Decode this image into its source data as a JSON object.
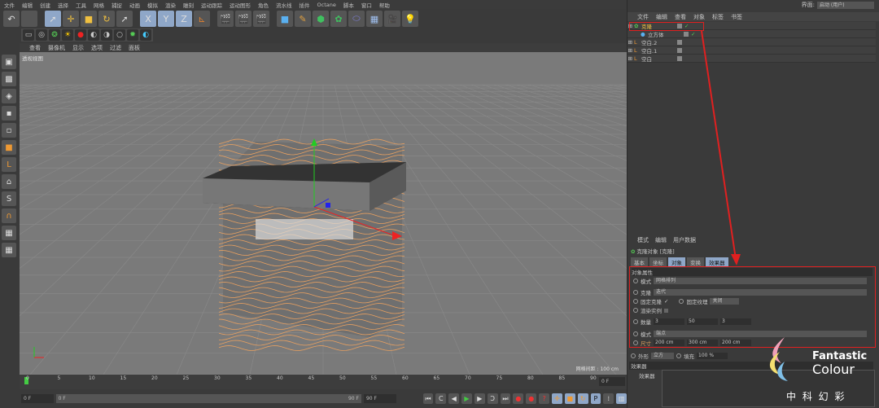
{
  "menu": [
    "文件",
    "编辑",
    "创建",
    "选择",
    "工具",
    "网格",
    "捕捉",
    "动画",
    "模拟",
    "渲染",
    "雕刻",
    "运动跟踪",
    "运动图形",
    "角色",
    "流水线",
    "插件",
    "Octane",
    "脚本",
    "窗口",
    "帮助"
  ],
  "interface": {
    "label": "界面:",
    "value": "启动 (用户)"
  },
  "viewport": {
    "menu": [
      "查看",
      "摄像机",
      "显示",
      "选项",
      "过滤",
      "面板"
    ],
    "label": "透视视图",
    "grid_spacing": "网格间距 : 100 cm"
  },
  "object_manager": {
    "menu": [
      "文件",
      "编辑",
      "查看",
      "对象",
      "标签",
      "书签"
    ],
    "objects": [
      "克隆",
      "立方体",
      "空白.2",
      "空白.1",
      "空白"
    ]
  },
  "attributes": {
    "menu": [
      "模式",
      "编辑",
      "用户数据"
    ],
    "title": "克隆对象 [克隆]",
    "tabs": [
      "基本",
      "坐标",
      "对象",
      "变换",
      "效果器"
    ],
    "section": "对象属性",
    "mode_label": "模式",
    "mode_value": "网格排列",
    "clone_label": "克隆",
    "clone_value": "迭代",
    "fix_clone": "固定克隆",
    "fix_clone_check": "✓",
    "fix_texture": "固定纹理",
    "fix_texture_value": "关闭",
    "render_instances": "渲染实例",
    "count_label": "数量",
    "count": [
      "3",
      "50",
      "3"
    ],
    "mode2_label": "模式",
    "mode2_value": "端点",
    "size_label": "尺寸",
    "size": [
      "200 cm",
      "300 cm",
      "200 cm"
    ],
    "shape_label": "外形",
    "shape_value": "立方",
    "fill_label": "填充",
    "fill_value": "100 %",
    "effectors_section": "效果器",
    "effectors_label": "效果器"
  },
  "timeline": {
    "ticks": [
      "0",
      "5",
      "10",
      "15",
      "20",
      "25",
      "30",
      "35",
      "40",
      "45",
      "50",
      "55",
      "60",
      "65",
      "70",
      "75",
      "80",
      "85",
      "90"
    ],
    "current": "0 F",
    "start": "0 F",
    "range_start": "0 F",
    "range_end": "90 F",
    "end": "90 F"
  },
  "logo": {
    "line1": "Fantastic",
    "line2": "Colour",
    "line3": "中 科 幻 彩"
  },
  "colors": {
    "accent": "#8fa7c8",
    "highlight": "#e02020",
    "clone_orange": "#e8a060"
  }
}
